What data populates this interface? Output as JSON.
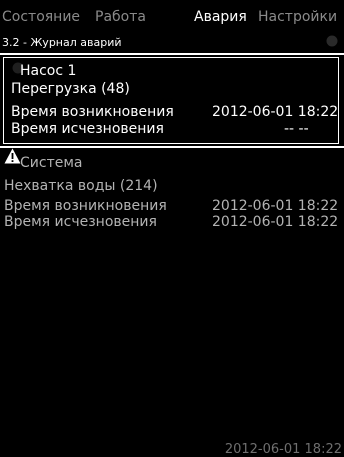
{
  "tabs": [
    {
      "label": "Состояние"
    },
    {
      "label": "Работа"
    },
    {
      "label": "Авария"
    },
    {
      "label": "Настройки"
    }
  ],
  "header": {
    "subtitle": "3.2 - Журнал аварий"
  },
  "alarms": [
    {
      "source": "Насос 1",
      "description": "Перегрузка (48)",
      "occurred_label": "Время возникновения",
      "occurred_value": "2012-06-01  18:22",
      "cleared_label": "Время исчезновения",
      "cleared_value": "--   --",
      "icon": "alarm-dot-icon"
    },
    {
      "source": "Система",
      "description": "Нехватка воды (214)",
      "occurred_label": "Время возникновения",
      "occurred_value": "2012-06-01  18:22",
      "cleared_label": "Время исчезновения",
      "cleared_value": "2012-06-01  18:22",
      "icon": "warning-triangle-icon"
    }
  ],
  "status_bar": {
    "datetime": "2012-06-01  18:22"
  }
}
